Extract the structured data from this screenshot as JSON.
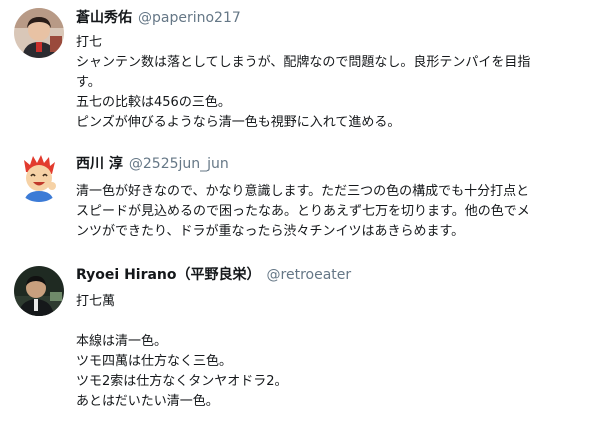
{
  "tweets": [
    {
      "name": "蒼山秀佑",
      "handle": "@paperino217",
      "lines": [
        "打七",
        "シャンテン数は落としてしまうが、配牌なので問題なし。良形テンパイを目指",
        "す。",
        "五七の比較は456の三色。",
        "ピンズが伸びるようなら清一色も視野に入れて進める。"
      ]
    },
    {
      "name": "西川 淳",
      "handle": "@2525jun_jun",
      "lines": [
        "清一色が好きなので、かなり意識します。ただ三つの色の構成でも十分打点と",
        "スピードが見込めるので困ったなあ。とりあえず七万を切ります。他の色でメ",
        "ンツができたり、ドラが重なったら渋々チンイツはあきらめます。"
      ]
    },
    {
      "name": "Ryoei Hirano（平野良栄）",
      "handle": "@retroeater",
      "lines": [
        "打七萬",
        "",
        "本線は清一色。",
        "ツモ四萬は仕方なく三色。",
        "ツモ2索は仕方なくタンヤオドラ2。",
        "あとはだいたい清一色。"
      ]
    }
  ]
}
